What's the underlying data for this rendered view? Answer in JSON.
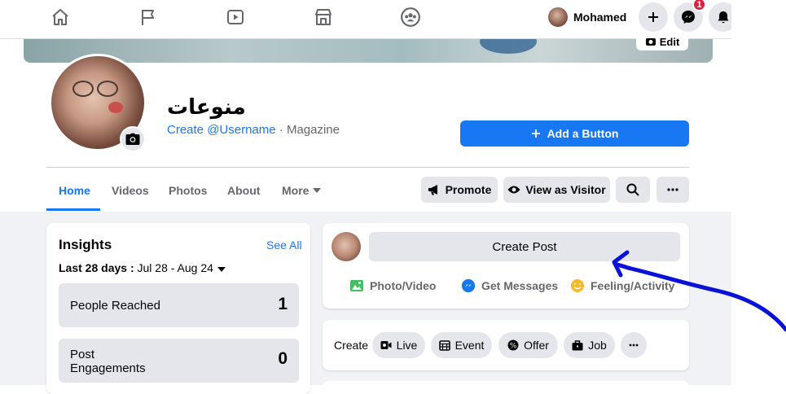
{
  "nav": {
    "user_name": "Mohamed",
    "notification_count": "1"
  },
  "cover": {
    "edit_label": "Edit"
  },
  "page": {
    "name": "منوعات",
    "username_link": "Create @Username",
    "separator": " · ",
    "category": "Magazine",
    "add_button_label": "Add a Button"
  },
  "tabs": [
    {
      "label": "Home",
      "active": true
    },
    {
      "label": "Videos"
    },
    {
      "label": "Photos"
    },
    {
      "label": "About"
    },
    {
      "label": "More"
    }
  ],
  "actions": {
    "promote": "Promote",
    "view_as_visitor": "View as Visitor"
  },
  "insights": {
    "title": "Insights",
    "see_all": "See All",
    "range_label": "Last 28 days :",
    "range_value": " Jul 28 - Aug 24",
    "stats": [
      {
        "label": "People Reached",
        "value": "1"
      },
      {
        "label": "Post\nEngagements",
        "value": "0"
      }
    ]
  },
  "create_post": {
    "button_label": "Create Post",
    "actions": [
      "Photo/Video",
      "Get Messages",
      "Feeling/Activity"
    ]
  },
  "create_row": {
    "label": "Create",
    "pills": [
      "Live",
      "Event",
      "Offer",
      "Job"
    ]
  },
  "colors": {
    "accent": "#1877f2",
    "annotation_arrow": "#0a12d8"
  }
}
